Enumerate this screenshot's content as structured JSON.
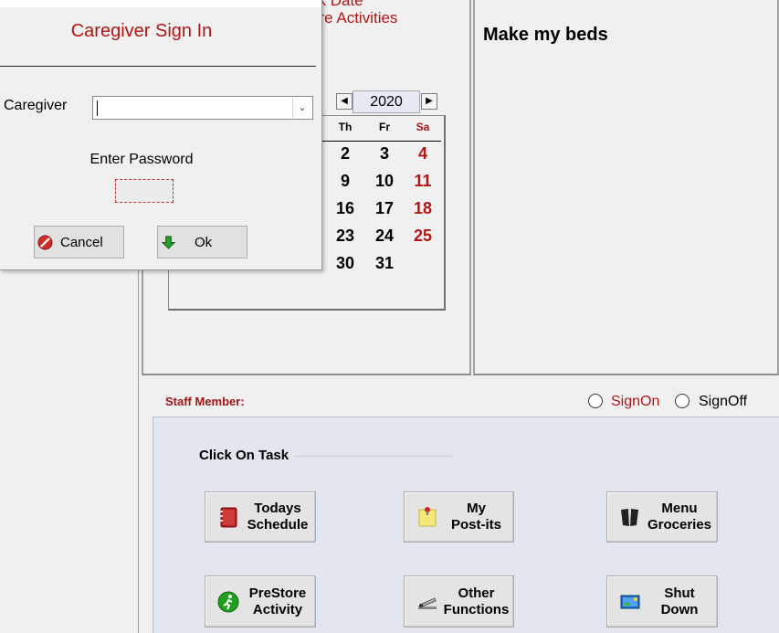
{
  "calendar": {
    "header_line1": "ck Date",
    "header_line2": "ure Activities",
    "year": "2020",
    "prev_icon": "triangle-left-icon",
    "next_icon": "triangle-right-icon",
    "dow": [
      "Th",
      "Fr",
      "Sa"
    ],
    "rows": [
      [
        "2",
        "3",
        "4"
      ],
      [
        "9",
        "10",
        "11"
      ],
      [
        "16",
        "17",
        "18"
      ],
      [
        "23",
        "24",
        "25"
      ],
      [
        "30",
        "31",
        ""
      ]
    ]
  },
  "note": {
    "text": "Make my beds"
  },
  "staff": {
    "label": "Staff Member:",
    "sign_on": "SignOn",
    "sign_off": "SignOff"
  },
  "tasks": {
    "title": "Click On Task",
    "buttons": [
      {
        "label": "Todays\nSchedule",
        "icon": "planner-book-icon"
      },
      {
        "label": "My\nPost-its",
        "icon": "sticky-note-icon"
      },
      {
        "label": "Menu\nGroceries",
        "icon": "menu-book-icon"
      },
      {
        "label": "PreStore\nActivity",
        "icon": "running-man-icon"
      },
      {
        "label": "Other\nFunctions",
        "icon": "stapler-icon"
      },
      {
        "label": "Shut\nDown",
        "icon": "monitor-power-icon"
      }
    ]
  },
  "dialog": {
    "title": "Caregiver Sign In",
    "caregiver_label": "Caregiver",
    "caregiver_value": "",
    "password_label": "Enter Password",
    "cancel_label": "Cancel",
    "ok_label": "Ok"
  },
  "colors": {
    "accent_red": "#b01616",
    "task_panel": "#e2e6ee"
  }
}
